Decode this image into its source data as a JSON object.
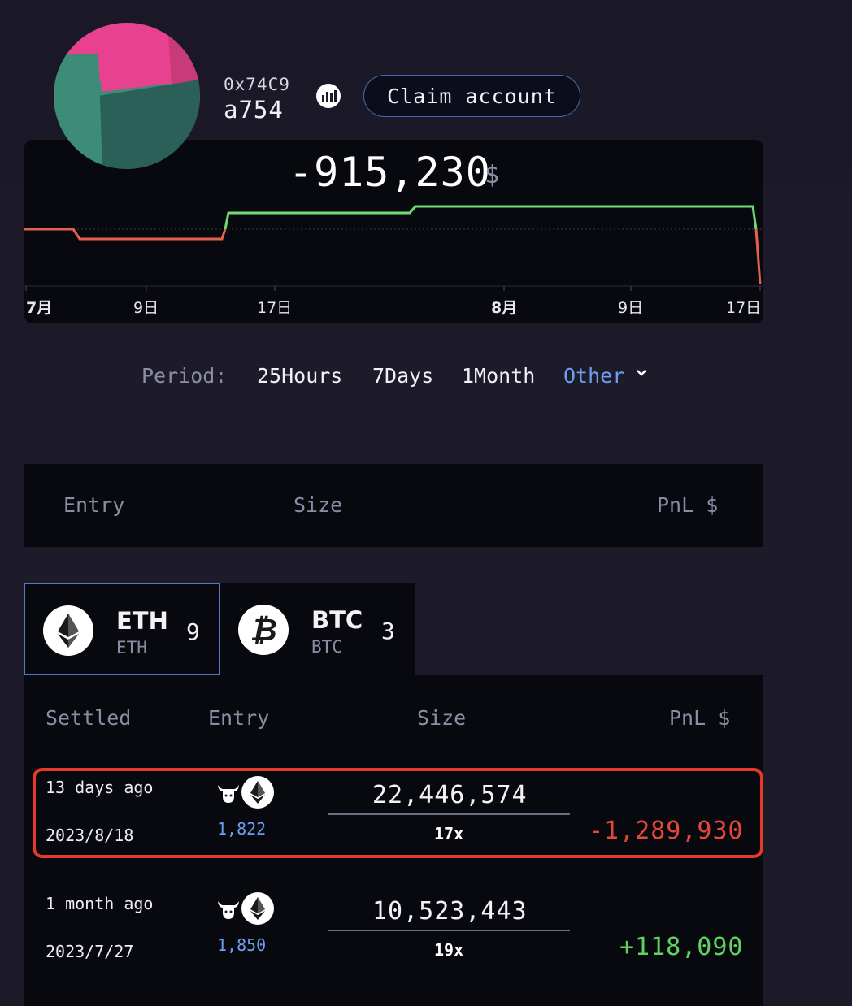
{
  "profile": {
    "address_prefix": "0x74C9",
    "address_suffix": "a754",
    "claim_button": "Claim account"
  },
  "summary": {
    "total_pnl": "-915,230",
    "currency": "$"
  },
  "chart_data": {
    "type": "line",
    "x_ticks": [
      "7月",
      "9日",
      "17日",
      "8月",
      "9日",
      "17日"
    ],
    "series": [
      {
        "values": [
          -30000,
          -30000,
          -60000,
          -60000,
          85000,
          85000,
          110000,
          110000,
          -915230
        ]
      }
    ]
  },
  "period": {
    "label": "Period:",
    "options": [
      "25Hours",
      "7Days",
      "1Month",
      "Other"
    ],
    "selected": "Other"
  },
  "summary_table": {
    "columns": [
      "Entry",
      "Size",
      "PnL $"
    ]
  },
  "tabs": [
    {
      "symbol": "ETH",
      "sub": "ETH",
      "count": "9",
      "active": true
    },
    {
      "symbol": "BTC",
      "sub": "BTC",
      "count": "3",
      "active": false
    }
  ],
  "trades": {
    "columns": [
      "Settled",
      "Entry",
      "Size",
      "PnL $"
    ],
    "rows": [
      {
        "rel_time": "13 days ago",
        "date": "2023/8/18",
        "entry": "1,822",
        "size": "22,446,574",
        "leverage": "17x",
        "pnl": "-1,289,930",
        "pnl_color": "#e5473a"
      },
      {
        "rel_time": "1 month ago",
        "date": "2023/7/27",
        "entry": "1,850",
        "size": "10,523,443",
        "leverage": "19x",
        "pnl": "+118,090",
        "pnl_color": "#5fd35f"
      }
    ]
  },
  "colors": {
    "accent": "#6f9df0",
    "loss": "#e5473a",
    "gain": "#5fd35f",
    "highlight": "#e5392a"
  }
}
